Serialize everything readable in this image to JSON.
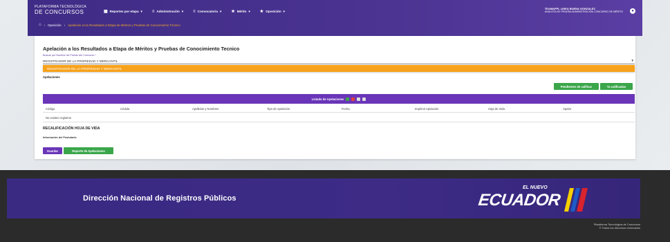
{
  "header": {
    "brand_line1": "PLATAFORMA TECNOLÓGICA",
    "brand_line2": "DE CONCURSOS",
    "nav": [
      {
        "label": "Reportes por etapa",
        "icon": "grid-icon"
      },
      {
        "label": "Administración",
        "icon": "list-icon"
      },
      {
        "label": "Convocatoria",
        "icon": "list-icon"
      },
      {
        "label": "Mérito",
        "icon": "star-icon"
      },
      {
        "label": "Oposición",
        "icon": "star-icon"
      }
    ],
    "user_name": "TEAMAPPL LINEA BUENA GONZALEZ",
    "user_role": "ANALISTA DE PRUEBA ADMINISTRACIÓN CONCURSO DE MÉRITO"
  },
  "breadcrumb": {
    "item1": "Oposición",
    "current": "Apelación a los Resultados a Etapa de Méritos y Pruebas de Conocimiento Técnico"
  },
  "main": {
    "title": "Apelación a los Resultados a Etapa de Méritos y Pruebas de Conocimiento Tecnico",
    "select_label": "Buscar por Nombre de Puesto del Concurso *",
    "select_value": "REGISTRADOR DE LA PROPIEDAD Y MERCANTIL",
    "dropdown_option": "REGISTRADOR DE LA PROPIEDAD Y MERCANTIL",
    "apelaciones_label": "Apelaciones",
    "btn_pendientes": "Pendientes de calificar",
    "btn_calificadas": "Ya calificadas",
    "table_title": "Listado de Apelaciones",
    "columns": [
      "Código",
      "Cédula",
      "Apellidos y Nombres",
      "Tipo de Apelación",
      "Fecha",
      "Imprimir Apelación",
      "Hoja de Vida",
      "Apelar"
    ],
    "empty_text": "No existen registros",
    "recal_title": "RECALIFICACIÓN HOJA DE VIDA",
    "info_label": "Información del Postulante",
    "btn_guardar": "Guardar",
    "btn_reporte": "Reporte de Apelaciones"
  },
  "footer": {
    "institution": "Dirección Nacional de Registros Públicos",
    "logo_small": "EL NUEVO",
    "logo_big": "ECUADOR",
    "copy1": "Plataforma Tecnológica de Concursos",
    "copy2": "© Todos los derechos reservados"
  },
  "colors": {
    "purple": "#4a3391",
    "orange": "#f7a21b",
    "green": "#3aa64a",
    "table_purple": "#6a35b8"
  }
}
